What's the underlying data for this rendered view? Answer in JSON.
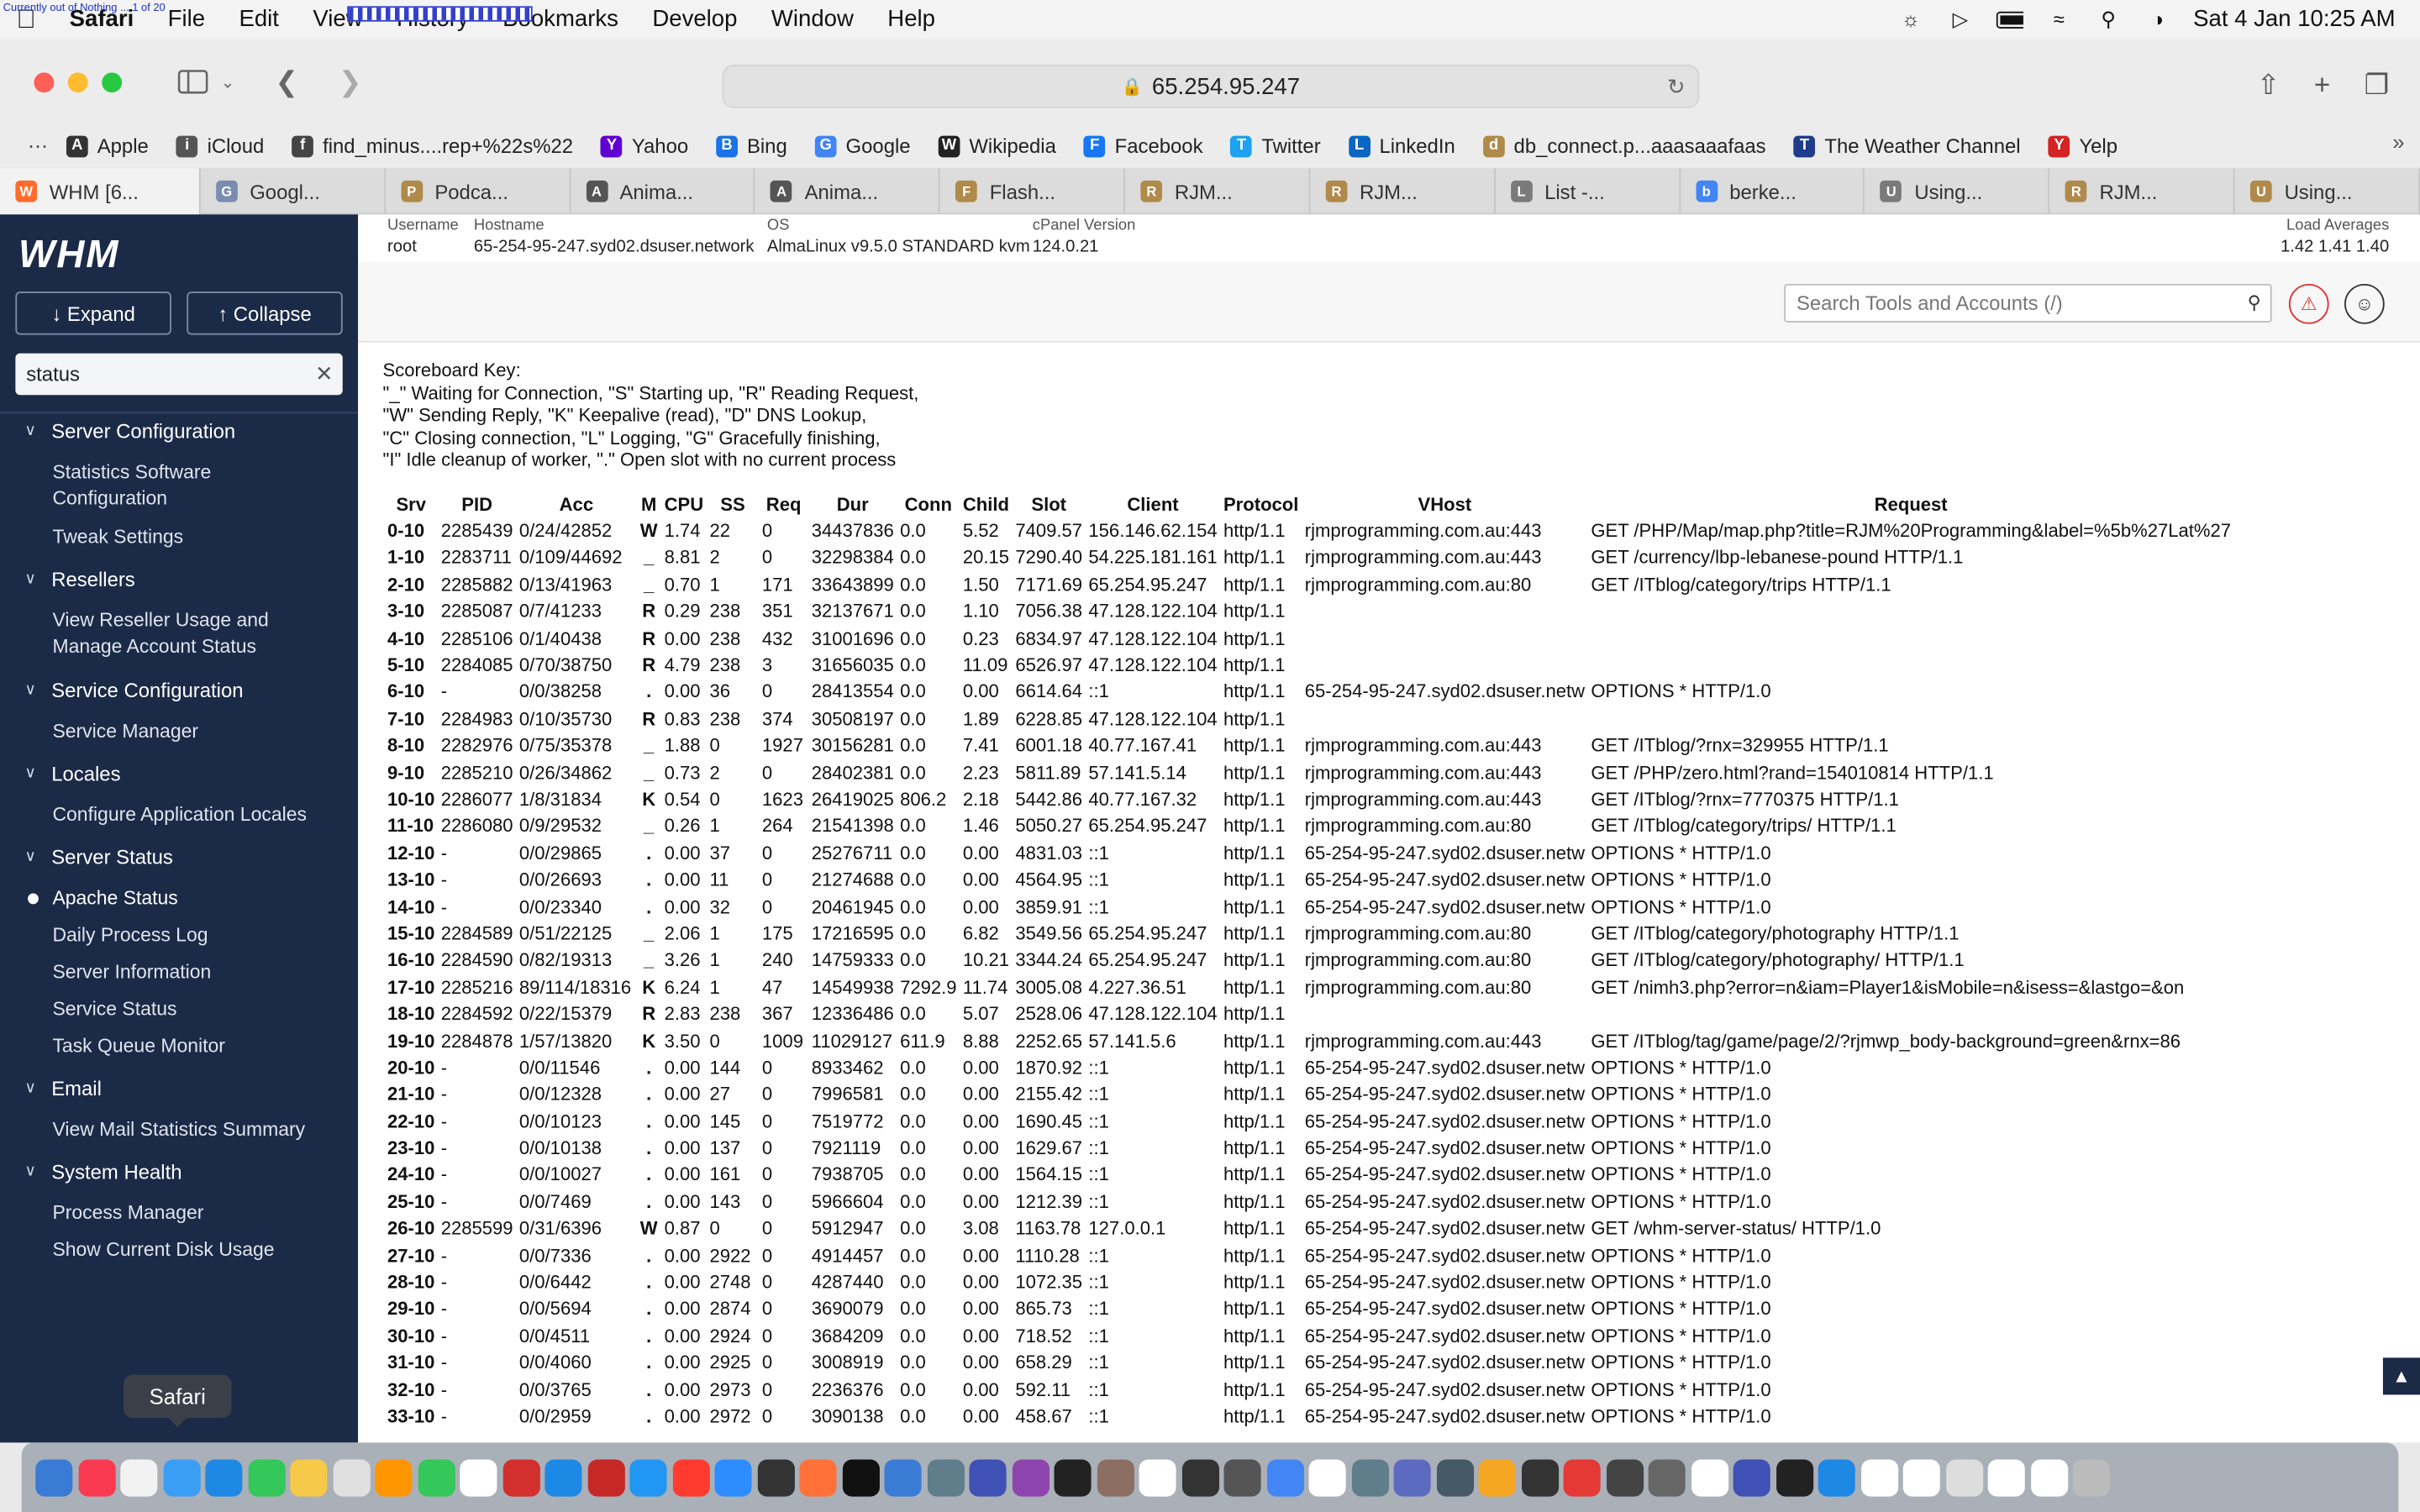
{
  "menubar": {
    "tiny_status": "Currently out of Nothing ... 1 of 20",
    "app": "Safari",
    "items": [
      "File",
      "Edit",
      "View",
      "History",
      "Bookmarks",
      "Develop",
      "Window",
      "Help"
    ],
    "clock": "Sat 4 Jan  10:25 AM"
  },
  "toolbar": {
    "address": "65.254.95.247"
  },
  "bookmarks": [
    {
      "label": "Apple",
      "color": "#333333"
    },
    {
      "label": "iCloud",
      "color": "#555555"
    },
    {
      "label": "find_minus....rep+%22s%22",
      "color": "#444444"
    },
    {
      "label": "Yahoo",
      "color": "#6001d2"
    },
    {
      "label": "Bing",
      "color": "#1a73e8"
    },
    {
      "label": "Google",
      "color": "#4285f4"
    },
    {
      "label": "Wikipedia",
      "color": "#222222"
    },
    {
      "label": "Facebook",
      "color": "#1877f2"
    },
    {
      "label": "Twitter",
      "color": "#1da1f2"
    },
    {
      "label": "LinkedIn",
      "color": "#0a66c2"
    },
    {
      "label": "db_connect.p...aaasaaafaas",
      "color": "#b08a4a"
    },
    {
      "label": "The Weather Channel",
      "color": "#1f3b8c"
    },
    {
      "label": "Yelp",
      "color": "#d32323"
    }
  ],
  "tabs": [
    {
      "label": "WHM [6...",
      "color": "#ff6c2c"
    },
    {
      "label": "Googl...",
      "color": "#7a8db0"
    },
    {
      "label": "Podca...",
      "color": "#b08a4a"
    },
    {
      "label": "Anima...",
      "color": "#555555"
    },
    {
      "label": "Anima...",
      "color": "#555555"
    },
    {
      "label": "Flash...",
      "color": "#b08a4a"
    },
    {
      "label": "RJM...",
      "color": "#b08a4a"
    },
    {
      "label": "RJM...",
      "color": "#b08a4a"
    },
    {
      "label": "List -...",
      "color": "#7a7a7a"
    },
    {
      "label": "berke...",
      "color": "#4285f4"
    },
    {
      "label": "Using...",
      "color": "#7a7a7a"
    },
    {
      "label": "RJM...",
      "color": "#b08a4a"
    },
    {
      "label": "Using...",
      "color": "#b08a4a"
    }
  ],
  "sidebar": {
    "logo": "WHM",
    "expand": "↓ Expand",
    "collapse": "↑ Collapse",
    "filter_value": "status",
    "groups": [
      {
        "label": "Server Configuration",
        "items": [
          "Statistics Software\nConfiguration",
          "Tweak Settings"
        ]
      },
      {
        "label": "Resellers",
        "items": [
          "View Reseller Usage and\nManage Account Status"
        ]
      },
      {
        "label": "Service Configuration",
        "items": [
          "Service Manager"
        ]
      },
      {
        "label": "Locales",
        "items": [
          "Configure Application Locales"
        ]
      },
      {
        "label": "Server Status",
        "items": [
          "Apache Status",
          "Daily Process Log",
          "Server Information",
          "Service Status",
          "Task Queue Monitor"
        ]
      },
      {
        "label": "Email",
        "items": [
          "View Mail Statistics Summary"
        ]
      },
      {
        "label": "System Health",
        "items": [
          "Process Manager",
          "Show Current Disk Usage"
        ]
      }
    ]
  },
  "info": {
    "username_label": "Username",
    "username": "root",
    "hostname_label": "Hostname",
    "hostname": "65-254-95-247.syd02.dsuser.network",
    "os_label": "OS",
    "os": "AlmaLinux v9.5.0 STANDARD kvm",
    "cpanel_label": "cPanel Version",
    "cpanel": "124.0.21",
    "load_label": "Load Averages",
    "load": "1.42  1.41  1.40"
  },
  "search_placeholder": "Search Tools and Accounts (/)",
  "scoreboard_key": [
    "Scoreboard Key:",
    "\"_\" Waiting for Connection, \"S\" Starting up, \"R\" Reading Request,",
    "\"W\" Sending Reply, \"K\" Keepalive (read), \"D\" DNS Lookup,",
    "\"C\" Closing connection, \"L\" Logging, \"G\" Gracefully finishing,",
    "\"I\" Idle cleanup of worker, \".\" Open slot with no current process"
  ],
  "table": {
    "headers": [
      "Srv",
      "PID",
      "Acc",
      "M",
      "CPU",
      "SS",
      "Req",
      "Dur",
      "Conn",
      "Child",
      "Slot",
      "Client",
      "Protocol",
      "VHost",
      "Request"
    ],
    "rows": [
      [
        "0-10",
        "2285439",
        "0/24/42852",
        "W",
        "1.74",
        "22",
        "0",
        "34437836",
        "0.0",
        "5.52",
        "7409.57",
        "156.146.62.154",
        "http/1.1",
        "rjmprogramming.com.au:443",
        "GET /PHP/Map/map.php?title=RJM%20Programming&label=%5b%27Lat%27"
      ],
      [
        "1-10",
        "2283711",
        "0/109/44692",
        "_",
        "8.81",
        "2",
        "0",
        "32298384",
        "0.0",
        "20.15",
        "7290.40",
        "54.225.181.161",
        "http/1.1",
        "rjmprogramming.com.au:443",
        "GET /currency/lbp-lebanese-pound HTTP/1.1"
      ],
      [
        "2-10",
        "2285882",
        "0/13/41963",
        "_",
        "0.70",
        "1",
        "171",
        "33643899",
        "0.0",
        "1.50",
        "7171.69",
        "65.254.95.247",
        "http/1.1",
        "rjmprogramming.com.au:80",
        "GET /ITblog/category/trips HTTP/1.1"
      ],
      [
        "3-10",
        "2285087",
        "0/7/41233",
        "R",
        "0.29",
        "238",
        "351",
        "32137671",
        "0.0",
        "1.10",
        "7056.38",
        "47.128.122.104",
        "http/1.1",
        "",
        ""
      ],
      [
        "4-10",
        "2285106",
        "0/1/40438",
        "R",
        "0.00",
        "238",
        "432",
        "31001696",
        "0.0",
        "0.23",
        "6834.97",
        "47.128.122.104",
        "http/1.1",
        "",
        ""
      ],
      [
        "5-10",
        "2284085",
        "0/70/38750",
        "R",
        "4.79",
        "238",
        "3",
        "31656035",
        "0.0",
        "11.09",
        "6526.97",
        "47.128.122.104",
        "http/1.1",
        "",
        ""
      ],
      [
        "6-10",
        "-",
        "0/0/38258",
        ".",
        "0.00",
        "36",
        "0",
        "28413554",
        "0.0",
        "0.00",
        "6614.64",
        "::1",
        "http/1.1",
        "65-254-95-247.syd02.dsuser.netw",
        "OPTIONS * HTTP/1.0"
      ],
      [
        "7-10",
        "2284983",
        "0/10/35730",
        "R",
        "0.83",
        "238",
        "374",
        "30508197",
        "0.0",
        "1.89",
        "6228.85",
        "47.128.122.104",
        "http/1.1",
        "",
        ""
      ],
      [
        "8-10",
        "2282976",
        "0/75/35378",
        "_",
        "1.88",
        "0",
        "1927",
        "30156281",
        "0.0",
        "7.41",
        "6001.18",
        "40.77.167.41",
        "http/1.1",
        "rjmprogramming.com.au:443",
        "GET /ITblog/?rnx=329955 HTTP/1.1"
      ],
      [
        "9-10",
        "2285210",
        "0/26/34862",
        "_",
        "0.73",
        "2",
        "0",
        "28402381",
        "0.0",
        "2.23",
        "5811.89",
        "57.141.5.14",
        "http/1.1",
        "rjmprogramming.com.au:443",
        "GET /PHP/zero.html?rand=154010814 HTTP/1.1"
      ],
      [
        "10-10",
        "2286077",
        "1/8/31834",
        "K",
        "0.54",
        "0",
        "1623",
        "26419025",
        "806.2",
        "2.18",
        "5442.86",
        "40.77.167.32",
        "http/1.1",
        "rjmprogramming.com.au:443",
        "GET /ITblog/?rnx=7770375 HTTP/1.1"
      ],
      [
        "11-10",
        "2286080",
        "0/9/29532",
        "_",
        "0.26",
        "1",
        "264",
        "21541398",
        "0.0",
        "1.46",
        "5050.27",
        "65.254.95.247",
        "http/1.1",
        "rjmprogramming.com.au:80",
        "GET /ITblog/category/trips/ HTTP/1.1"
      ],
      [
        "12-10",
        "-",
        "0/0/29865",
        ".",
        "0.00",
        "37",
        "0",
        "25276711",
        "0.0",
        "0.00",
        "4831.03",
        "::1",
        "http/1.1",
        "65-254-95-247.syd02.dsuser.netw",
        "OPTIONS * HTTP/1.0"
      ],
      [
        "13-10",
        "-",
        "0/0/26693",
        ".",
        "0.00",
        "11",
        "0",
        "21274688",
        "0.0",
        "0.00",
        "4564.95",
        "::1",
        "http/1.1",
        "65-254-95-247.syd02.dsuser.netw",
        "OPTIONS * HTTP/1.0"
      ],
      [
        "14-10",
        "-",
        "0/0/23340",
        ".",
        "0.00",
        "32",
        "0",
        "20461945",
        "0.0",
        "0.00",
        "3859.91",
        "::1",
        "http/1.1",
        "65-254-95-247.syd02.dsuser.netw",
        "OPTIONS * HTTP/1.0"
      ],
      [
        "15-10",
        "2284589",
        "0/51/22125",
        "_",
        "2.06",
        "1",
        "175",
        "17216595",
        "0.0",
        "6.82",
        "3549.56",
        "65.254.95.247",
        "http/1.1",
        "rjmprogramming.com.au:80",
        "GET /ITblog/category/photography HTTP/1.1"
      ],
      [
        "16-10",
        "2284590",
        "0/82/19313",
        "_",
        "3.26",
        "1",
        "240",
        "14759333",
        "0.0",
        "10.21",
        "3344.24",
        "65.254.95.247",
        "http/1.1",
        "rjmprogramming.com.au:80",
        "GET /ITblog/category/photography/ HTTP/1.1"
      ],
      [
        "17-10",
        "2285216",
        "89/114/18316",
        "K",
        "6.24",
        "1",
        "47",
        "14549938",
        "7292.9",
        "11.74",
        "3005.08",
        "4.227.36.51",
        "http/1.1",
        "rjmprogramming.com.au:80",
        "GET /nimh3.php?error=n&iam=Player1&isMobile=n&isess=&lastgo=&on"
      ],
      [
        "18-10",
        "2284592",
        "0/22/15379",
        "R",
        "2.83",
        "238",
        "367",
        "12336486",
        "0.0",
        "5.07",
        "2528.06",
        "47.128.122.104",
        "http/1.1",
        "",
        ""
      ],
      [
        "19-10",
        "2284878",
        "1/57/13820",
        "K",
        "3.50",
        "0",
        "1009",
        "11029127",
        "611.9",
        "8.88",
        "2252.65",
        "57.141.5.6",
        "http/1.1",
        "rjmprogramming.com.au:443",
        "GET /ITblog/tag/game/page/2/?rjmwp_body-background=green&rnx=86"
      ],
      [
        "20-10",
        "-",
        "0/0/11546",
        ".",
        "0.00",
        "144",
        "0",
        "8933462",
        "0.0",
        "0.00",
        "1870.92",
        "::1",
        "http/1.1",
        "65-254-95-247.syd02.dsuser.netw",
        "OPTIONS * HTTP/1.0"
      ],
      [
        "21-10",
        "-",
        "0/0/12328",
        ".",
        "0.00",
        "27",
        "0",
        "7996581",
        "0.0",
        "0.00",
        "2155.42",
        "::1",
        "http/1.1",
        "65-254-95-247.syd02.dsuser.netw",
        "OPTIONS * HTTP/1.0"
      ],
      [
        "22-10",
        "-",
        "0/0/10123",
        ".",
        "0.00",
        "145",
        "0",
        "7519772",
        "0.0",
        "0.00",
        "1690.45",
        "::1",
        "http/1.1",
        "65-254-95-247.syd02.dsuser.netw",
        "OPTIONS * HTTP/1.0"
      ],
      [
        "23-10",
        "-",
        "0/0/10138",
        ".",
        "0.00",
        "137",
        "0",
        "7921119",
        "0.0",
        "0.00",
        "1629.67",
        "::1",
        "http/1.1",
        "65-254-95-247.syd02.dsuser.netw",
        "OPTIONS * HTTP/1.0"
      ],
      [
        "24-10",
        "-",
        "0/0/10027",
        ".",
        "0.00",
        "161",
        "0",
        "7938705",
        "0.0",
        "0.00",
        "1564.15",
        "::1",
        "http/1.1",
        "65-254-95-247.syd02.dsuser.netw",
        "OPTIONS * HTTP/1.0"
      ],
      [
        "25-10",
        "-",
        "0/0/7469",
        ".",
        "0.00",
        "143",
        "0",
        "5966604",
        "0.0",
        "0.00",
        "1212.39",
        "::1",
        "http/1.1",
        "65-254-95-247.syd02.dsuser.netw",
        "OPTIONS * HTTP/1.0"
      ],
      [
        "26-10",
        "2285599",
        "0/31/6396",
        "W",
        "0.87",
        "0",
        "0",
        "5912947",
        "0.0",
        "3.08",
        "1163.78",
        "127.0.0.1",
        "http/1.1",
        "65-254-95-247.syd02.dsuser.netw",
        "GET /whm-server-status/ HTTP/1.0"
      ],
      [
        "27-10",
        "-",
        "0/0/7336",
        ".",
        "0.00",
        "2922",
        "0",
        "4914457",
        "0.0",
        "0.00",
        "1110.28",
        "::1",
        "http/1.1",
        "65-254-95-247.syd02.dsuser.netw",
        "OPTIONS * HTTP/1.0"
      ],
      [
        "28-10",
        "-",
        "0/0/6442",
        ".",
        "0.00",
        "2748",
        "0",
        "4287440",
        "0.0",
        "0.00",
        "1072.35",
        "::1",
        "http/1.1",
        "65-254-95-247.syd02.dsuser.netw",
        "OPTIONS * HTTP/1.0"
      ],
      [
        "29-10",
        "-",
        "0/0/5694",
        ".",
        "0.00",
        "2874",
        "0",
        "3690079",
        "0.0",
        "0.00",
        "865.73",
        "::1",
        "http/1.1",
        "65-254-95-247.syd02.dsuser.netw",
        "OPTIONS * HTTP/1.0"
      ],
      [
        "30-10",
        "-",
        "0/0/4511",
        ".",
        "0.00",
        "2924",
        "0",
        "3684209",
        "0.0",
        "0.00",
        "718.52",
        "::1",
        "http/1.1",
        "65-254-95-247.syd02.dsuser.netw",
        "OPTIONS * HTTP/1.0"
      ],
      [
        "31-10",
        "-",
        "0/0/4060",
        ".",
        "0.00",
        "2925",
        "0",
        "3008919",
        "0.0",
        "0.00",
        "658.29",
        "::1",
        "http/1.1",
        "65-254-95-247.syd02.dsuser.netw",
        "OPTIONS * HTTP/1.0"
      ],
      [
        "32-10",
        "-",
        "0/0/3765",
        ".",
        "0.00",
        "2973",
        "0",
        "2236376",
        "0.0",
        "0.00",
        "592.11",
        "::1",
        "http/1.1",
        "65-254-95-247.syd02.dsuser.netw",
        "OPTIONS * HTTP/1.0"
      ],
      [
        "33-10",
        "-",
        "0/0/2959",
        ".",
        "0.00",
        "2972",
        "0",
        "3090138",
        "0.0",
        "0.00",
        "458.67",
        "::1",
        "http/1.1",
        "65-254-95-247.syd02.dsuser.netw",
        "OPTIONS * HTTP/1.0"
      ]
    ]
  },
  "tooltip": "Safari",
  "dock_colors": [
    "#3a7bd5",
    "#fa3a50",
    "#f2f2f2",
    "#3a9ef5",
    "#1e88e5",
    "#34c759",
    "#f7c948",
    "#e0e0e0",
    "#ff9500",
    "#34c759",
    "#ffffff",
    "#d32f2f",
    "#1e88e5",
    "#c62828",
    "#2196f3",
    "#ff3b30",
    "#2d8cff",
    "#333333",
    "#ff7139",
    "#111111",
    "#3a7bd5",
    "#607d8b",
    "#3f51b5",
    "#8e44ad",
    "#222222",
    "#8d6e63",
    "#ffffff",
    "#333333",
    "#555555",
    "#4285f4",
    "#ffffff",
    "#607d8b",
    "#5c6bc0",
    "#455a64",
    "#f5a623",
    "#333333",
    "#e53935",
    "#444444",
    "#666666",
    "#ffffff",
    "#3f51b5",
    "#222222",
    "#1e88e5",
    "#ffffff",
    "#ffffff",
    "#dddddd",
    "#ffffff",
    "#ffffff",
    "#bbbbbb"
  ]
}
